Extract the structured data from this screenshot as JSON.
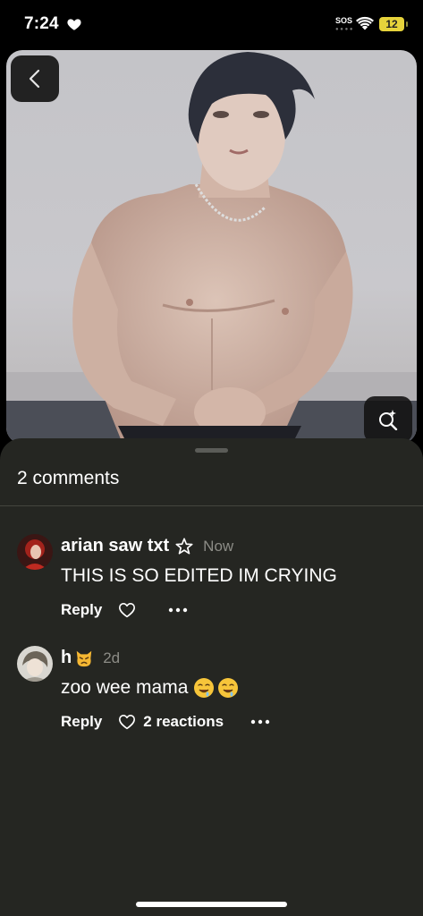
{
  "status_bar": {
    "time": "7:24",
    "sos": "SOS",
    "battery": "12"
  },
  "photo": {
    "back_icon": "chevron-left-icon",
    "lens_icon": "visual-search-icon"
  },
  "sheet": {
    "comments_count": "2 comments",
    "comments": [
      {
        "author": "arian saw txt",
        "author_badge": "star-icon",
        "time": "Now",
        "text": "THIS IS SO EDITED IM CRYING",
        "reply_label": "Reply",
        "reactions": ""
      },
      {
        "author": "h",
        "author_badge": "pouting-cat-emoji",
        "time": "2d",
        "text": "zoo wee mama",
        "text_emoji": "drooling-face-emoji",
        "reply_label": "Reply",
        "reactions": "2 reactions"
      }
    ]
  },
  "colors": {
    "sheet_bg": "#252622",
    "battery": "#e6d33b",
    "muted_text": "#8c8c86"
  }
}
